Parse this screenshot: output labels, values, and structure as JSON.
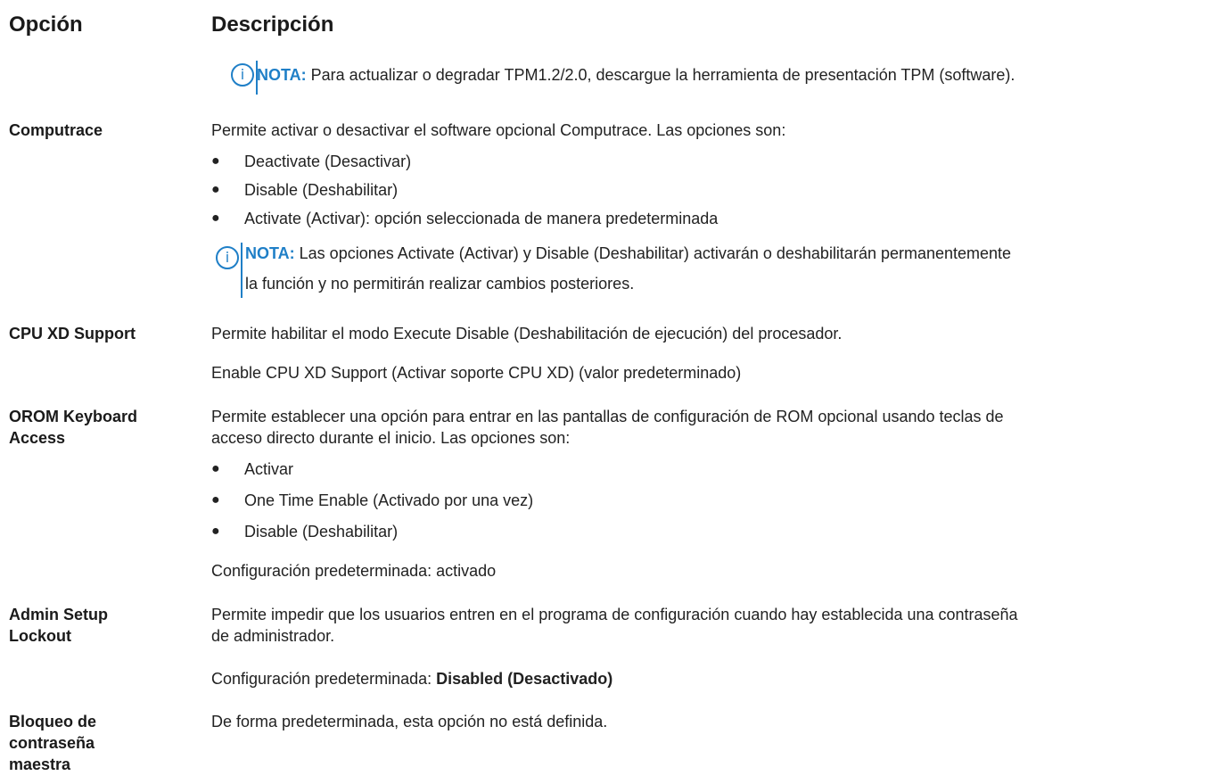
{
  "headers": {
    "option": "Opción",
    "description": "Descripción"
  },
  "top_note": {
    "label": "NOTA:",
    "text": " Para actualizar o degradar TPM1.2/2.0, descargue la herramienta de presentación TPM (software)."
  },
  "computrace": {
    "option": "Computrace",
    "intro": "Permite activar o desactivar el software opcional Computrace. Las opciones son:",
    "bullets": [
      "Deactivate (Desactivar)",
      "Disable (Deshabilitar)",
      "Activate (Activar): opción seleccionada de manera predeterminada"
    ],
    "note_label": "NOTA:",
    "note_line1": " Las opciones Activate (Activar) y Disable (Deshabilitar) activarán o deshabilitarán permanentemente",
    "note_line2": "la función y no permitirán realizar cambios posteriores."
  },
  "cpu_xd": {
    "option": "CPU XD Support",
    "line1": "Permite habilitar el modo Execute Disable (Deshabilitación de ejecución) del procesador.",
    "line2": "Enable CPU XD Support (Activar soporte CPU XD) (valor predeterminado)"
  },
  "orom": {
    "option_line1": "OROM Keyboard",
    "option_line2": "Access",
    "line1": "Permite establecer una opción para entrar en las pantallas de configuración de ROM opcional usando teclas de",
    "line2": "acceso directo durante el inicio. Las opciones son:",
    "bullets": [
      "Activar",
      "One Time Enable (Activado por una vez)",
      "Disable (Deshabilitar)"
    ],
    "default": "Configuración predeterminada: activado"
  },
  "admin": {
    "option_line1": "Admin Setup",
    "option_line2": "Lockout",
    "line1": "Permite impedir que los usuarios entren en el programa de configuración cuando hay establecida una contraseña",
    "line2": "de administrador.",
    "default_prefix": "Configuración predeterminada: ",
    "default_value": "Disabled (Desactivado)"
  },
  "master_pw": {
    "option_line1": "Bloqueo de",
    "option_line2": "contraseña",
    "option_line3": "maestra",
    "text": "De forma predeterminada, esta opción no está definida."
  },
  "colors": {
    "accent": "#1f7fc7",
    "text": "#222222"
  },
  "icons": {
    "note": "info-icon",
    "bullet": "bullet-dot"
  }
}
